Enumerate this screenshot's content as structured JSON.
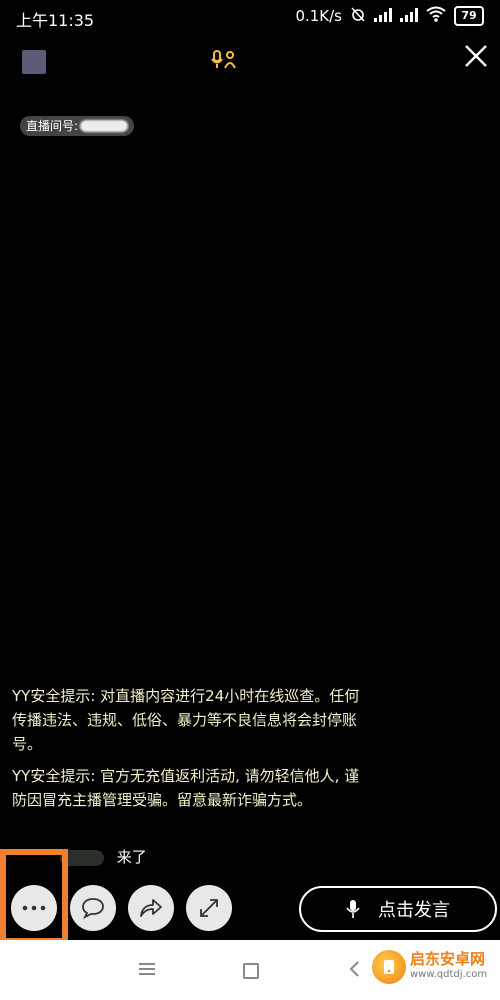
{
  "status_bar": {
    "time": "上午11:35",
    "network_speed": "0.1K/s",
    "battery_level": "79"
  },
  "header": {
    "room_id_label": "直播间号:"
  },
  "notices": [
    "YY安全提示: 对直播内容进行24小时在线巡查。任何传播违法、违规、低俗、暴力等不良信息将会封停账号。",
    "YY安全提示: 官方无充值返利活动, 请勿轻信他人, 谨防因冒充主播管理受骗。留意最新诈骗方式。"
  ],
  "joined_text": "来了",
  "toolbar": {
    "speak_label": "点击发言"
  },
  "watermark": {
    "title": "启东安卓网",
    "url": "www.qdtdj.com"
  },
  "colors": {
    "notice_text": "#f3f0c8",
    "highlight": "#f08030",
    "accent_yellow": "#f6c23a"
  }
}
